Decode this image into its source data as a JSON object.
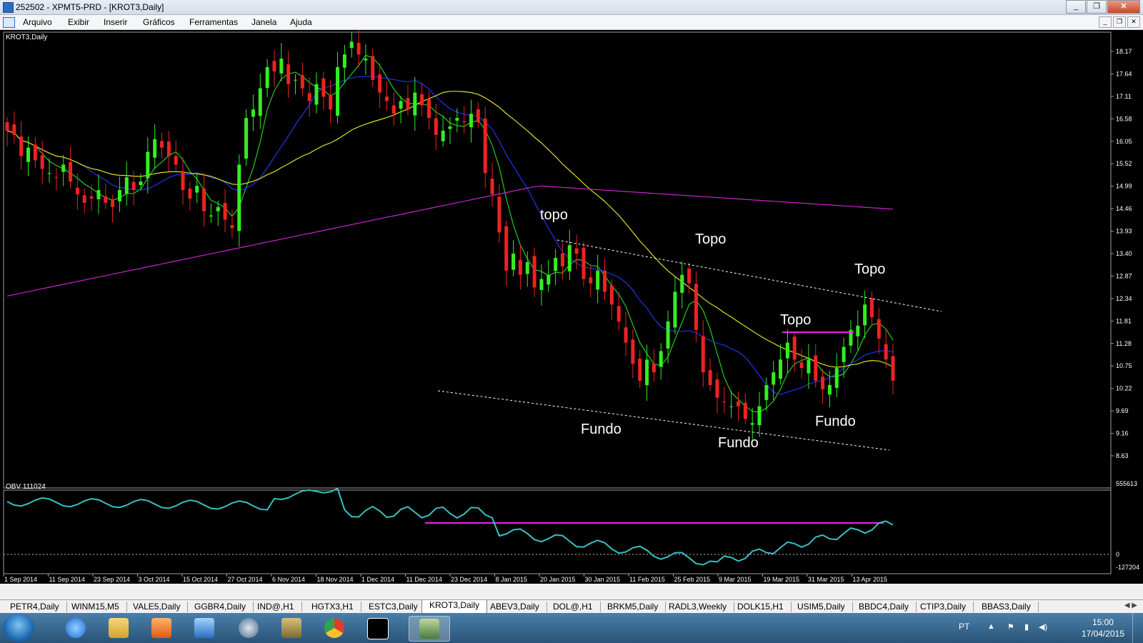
{
  "window": {
    "title": "252502 - XPMT5-PRD - [KROT3,Daily]"
  },
  "menu": {
    "items": [
      "Arquivo",
      "Exibir",
      "Inserir",
      "Gráficos",
      "Ferramentas",
      "Janela",
      "Ajuda"
    ]
  },
  "chart": {
    "symbol_label": "KROT3,Daily",
    "price_axis": [
      "18.17",
      "17.64",
      "17.11",
      "16.58",
      "16.05",
      "15.52",
      "14.99",
      "14.46",
      "13.93",
      "13.40",
      "12.87",
      "12.34",
      "11.81",
      "11.28",
      "10.75",
      "10.22",
      "9.69",
      "9.16",
      "8.63"
    ],
    "date_axis": [
      "1 Sep 2014",
      "11 Sep 2014",
      "23 Sep 2014",
      "3 Oct 2014",
      "15 Oct 2014",
      "27 Oct 2014",
      "6 Nov 2014",
      "18 Nov 2014",
      "1 Dec 2014",
      "11 Dec 2014",
      "23 Dec 2014",
      "8 Jan 2015",
      "20 Jan 2015",
      "30 Jan 2015",
      "11 Feb 2015",
      "25 Feb 2015",
      "9 Mar 2015",
      "19 Mar 2015",
      "31 Mar 2015",
      "13 Apr 2015"
    ],
    "annotations": {
      "topo1": "topo",
      "topo2": "Topo",
      "topo3": "Topo",
      "topo4": "Topo",
      "fundo1": "Fundo",
      "fundo2": "Fundo",
      "fundo3": "Fundo"
    },
    "obv": {
      "label": "OBV 111024",
      "axis_top": "555613",
      "axis_zero": "0",
      "axis_bottom": "-127204"
    },
    "colors": {
      "bull": "#33ee22",
      "bear": "#ee2222",
      "ma_fast": "#22cc22",
      "ma_mid": "#2233ee",
      "ma_slow": "#dddd22",
      "ma_long": "#cc22cc",
      "obv_line": "#39c0c4",
      "obv_level": "#ee22ee"
    }
  },
  "chart_data": {
    "type": "candlestick",
    "symbol": "KROT3",
    "timeframe": "Daily",
    "ylim": [
      8.3,
      18.4
    ],
    "closes": [
      16.3,
      16.2,
      15.7,
      15.9,
      15.6,
      15.4,
      15.3,
      15.2,
      15.5,
      15.1,
      14.8,
      14.6,
      14.7,
      14.9,
      14.6,
      14.5,
      14.9,
      15.2,
      14.9,
      15.1,
      15.8,
      16.1,
      15.9,
      15.7,
      15.5,
      14.9,
      14.7,
      15.0,
      14.4,
      14.3,
      14.5,
      14.2,
      14.0,
      15.5,
      16.6,
      16.8,
      17.3,
      17.8,
      17.7,
      18.0,
      17.4,
      17.5,
      17.3,
      17.0,
      17.4,
      17.1,
      16.8,
      17.8,
      18.1,
      18.4,
      18.1,
      18.0,
      17.5,
      17.2,
      17.0,
      16.7,
      17.0,
      16.8,
      17.2,
      16.9,
      16.6,
      16.2,
      16.3,
      16.4,
      16.6,
      16.5,
      16.7,
      16.5,
      15.3,
      14.8,
      13.9,
      13.0,
      13.4,
      12.9,
      13.2,
      12.6,
      12.8,
      12.9,
      13.3,
      13.1,
      13.6,
      13.4,
      12.8,
      12.7,
      13.0,
      12.5,
      12.2,
      11.8,
      11.3,
      10.8,
      10.4,
      10.9,
      10.6,
      11.1,
      11.8,
      12.5,
      12.9,
      12.7,
      11.6,
      10.6,
      10.3,
      10.0,
      9.9,
      9.8,
      9.8,
      9.5,
      9.4,
      9.8,
      10.3,
      10.6,
      10.9,
      11.3,
      10.9,
      10.7,
      10.9,
      10.4,
      10.2,
      10.3,
      10.7,
      11.2,
      11.6,
      11.7,
      12.2,
      11.9,
      11.4,
      10.9,
      10.4
    ]
  },
  "tabs": [
    "PETR4,Daily",
    "WINM15,M5",
    "VALE5,Daily",
    "GGBR4,Daily",
    "IND@,H1",
    "HGTX3,H1",
    "ESTC3,Daily",
    "KROT3,Daily",
    "ABEV3,Daily",
    "DOL@,H1",
    "BRKM5,Daily",
    "RADL3,Weekly",
    "DOLK15,H1",
    "USIM5,Daily",
    "BBDC4,Daily",
    "CTIP3,Daily",
    "BBAS3,Daily"
  ],
  "active_tab": "KROT3,Daily",
  "taskbar": {
    "icons": [
      "start-orb",
      "ie-icon",
      "explorer-icon",
      "media-player-icon",
      "network-icon",
      "hp-icon",
      "files-icon",
      "chrome-icon",
      "xp-icon",
      "metatrader-icon"
    ],
    "lang": "PT",
    "time": "15:00",
    "date": "17/04/2015"
  }
}
